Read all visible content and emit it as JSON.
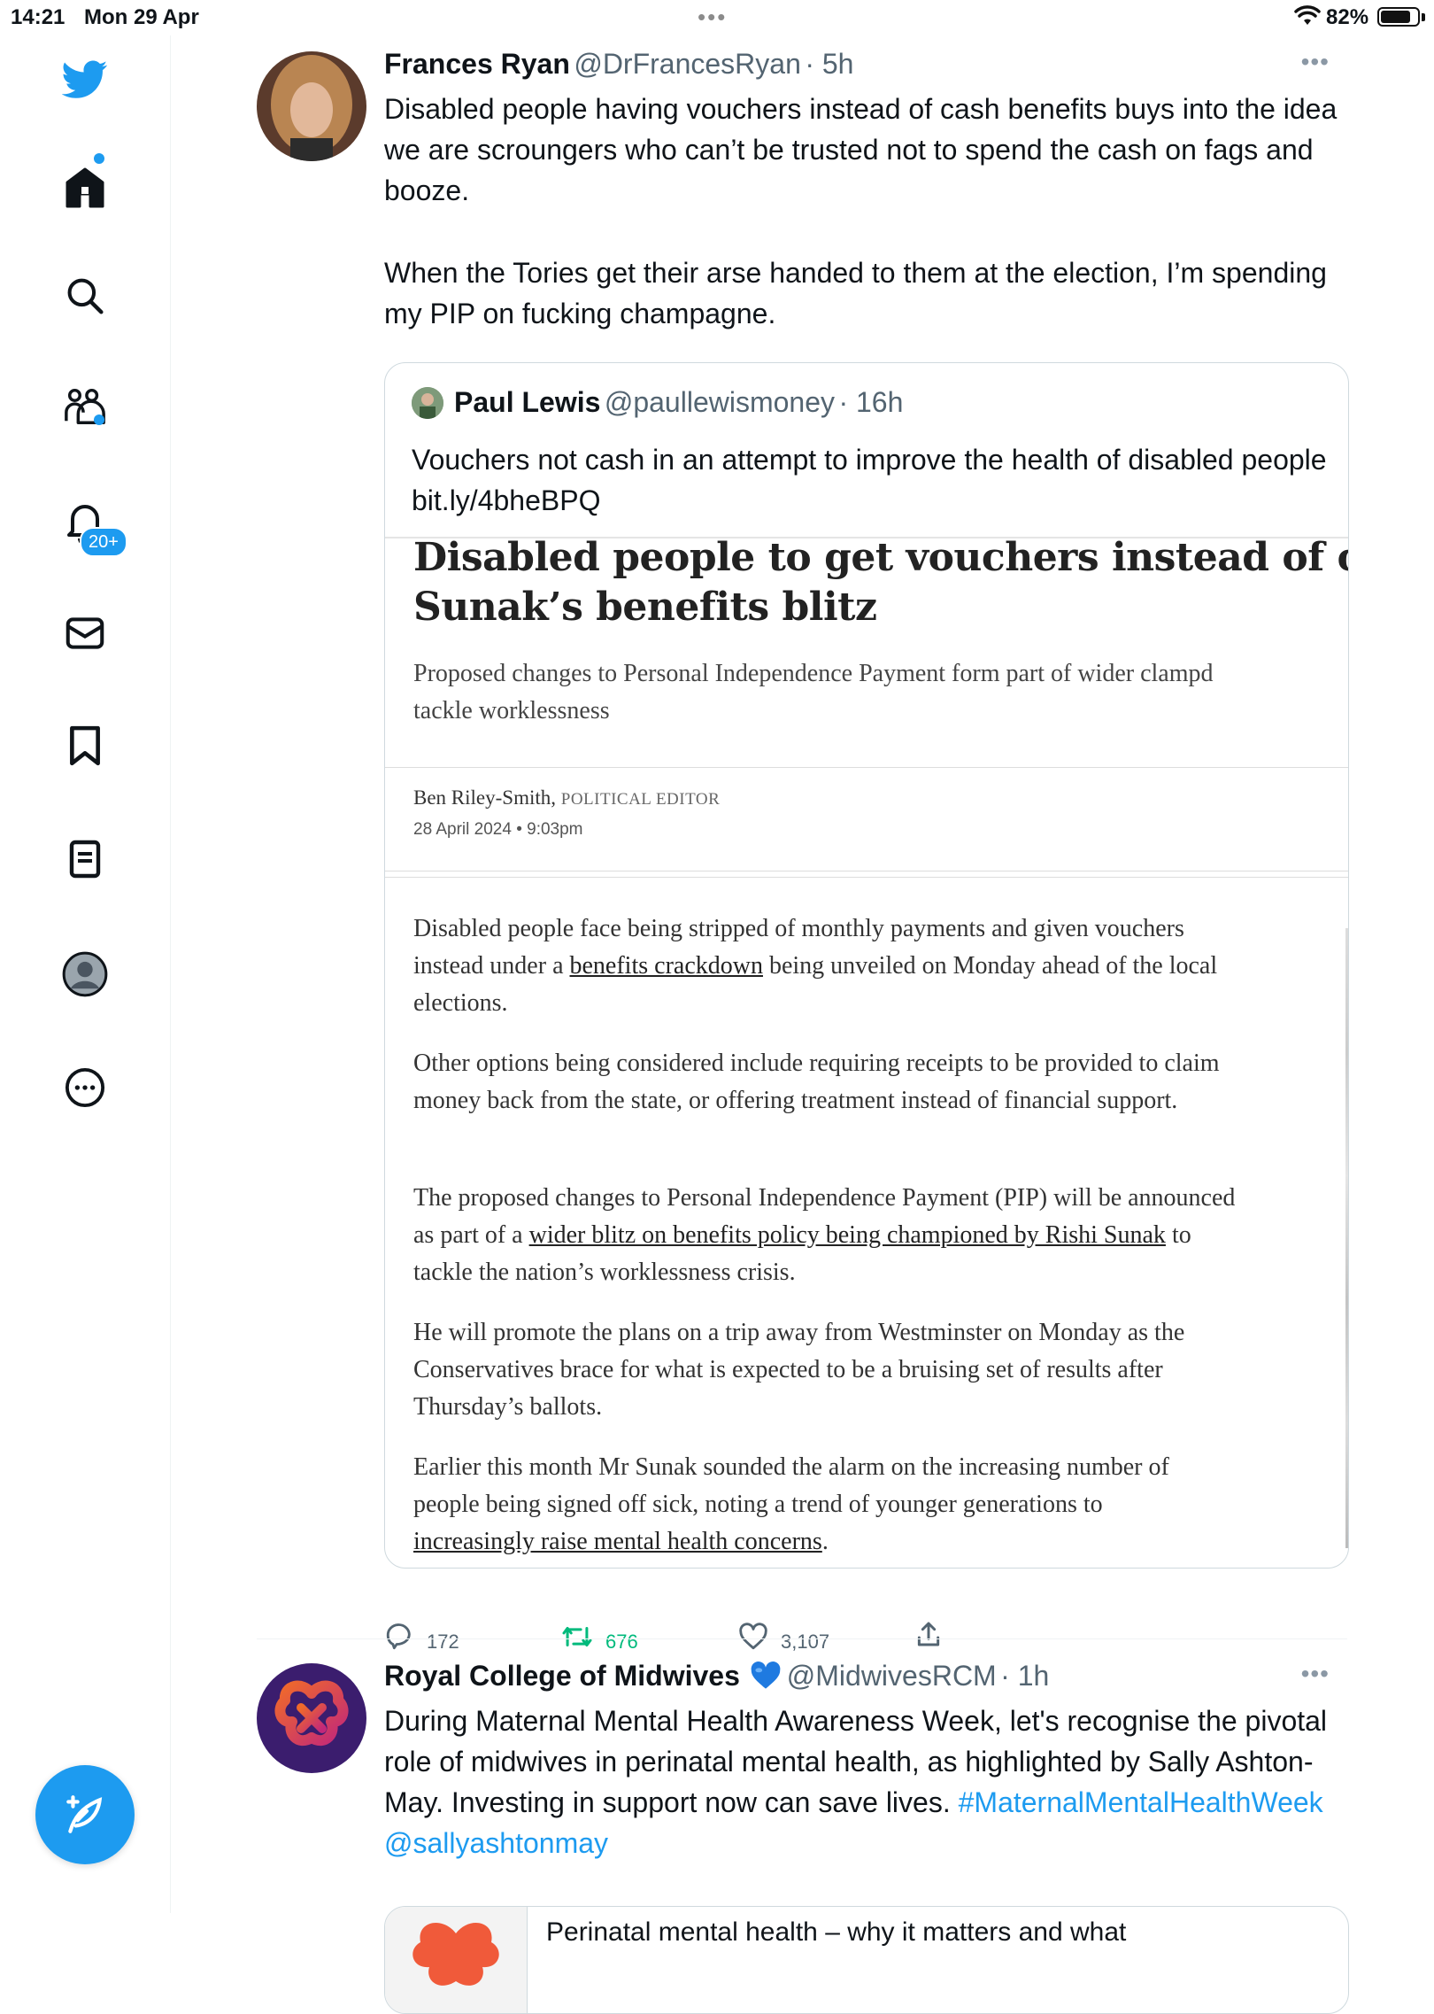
{
  "status_bar": {
    "time": "14:21",
    "date": "Mon 29 Apr",
    "battery": "82%",
    "battery_level": 0.82
  },
  "sidebar": {
    "notifications_badge": "20+",
    "icons": [
      "twitter-bird-icon",
      "home-icon",
      "search-icon",
      "communities-icon",
      "notifications-icon",
      "messages-icon",
      "bookmarks-icon",
      "lists-icon",
      "profile-icon",
      "more-icon"
    ],
    "accent": "#1d9bf0"
  },
  "tweet1": {
    "name": "Frances Ryan",
    "handle": "@DrFrancesRyan",
    "time": "· 5h",
    "text_p1": "Disabled people having vouchers instead of cash benefits buys into the idea we are scroungers who can’t be trusted not to spend the cash on fags and booze.",
    "text_p2": "When the Tories get their arse handed to them at the election, I’m spending my PIP on fucking champagne.",
    "quote": {
      "name": "Paul Lewis",
      "handle": "@paullewismoney",
      "time": "· 16h",
      "text": "Vouchers not cash in an attempt to improve the health of disabled people bit.ly/4bheBPQ",
      "article": {
        "title_l1": "Disabled people to get vouchers instead of cash in",
        "title_l2": "Sunak’s benefits blitz",
        "sub_l1": "Proposed changes to Personal Independence Payment form part of wider clampd",
        "sub_l2": "tackle worklessness",
        "author": "Ben Riley-Smith,",
        "role": "POLITICAL EDITOR",
        "date": "28 April 2024 • 9:03pm",
        "p1_a": "Disabled people face being stripped of monthly payments and given vouchers instead under a ",
        "p1_link": "benefits crackdown",
        "p1_b": " being unveiled on Monday ahead of the local elections.",
        "p2": "Other options being considered include requiring receipts to be provided to claim money back from the state, or offering treatment instead of financial support.",
        "p3_a": "The proposed changes to Personal Independence Payment (PIP) will be announced as part of a ",
        "p3_link": "wider blitz on benefits policy being championed by Rishi Sunak",
        "p3_b": " to tackle the nation’s worklessness crisis.",
        "p4": "He will promote the plans on a trip away from Westminster on Monday as the Conservatives brace for what is expected to be a bruising set of results after Thursday’s ballots.",
        "p5_a": "Earlier this month Mr Sunak sounded the alarm on the increasing number of people being signed off sick, noting a trend of younger generations to ",
        "p5_link": "increasingly raise mental health concerns",
        "p5_b": "."
      }
    },
    "replies": "172",
    "retweets": "676",
    "likes": "3,107"
  },
  "tweet2": {
    "name": "Royal College of Midwives",
    "handle": "@MidwivesRCM",
    "time": "· 1h",
    "text": "During Maternal Mental Health Awareness Week, let's recognise the pivotal role of midwives in perinatal mental health, as highlighted by Sally Ashton-May. Investing in support now can save lives.",
    "hashtag": "#MaternalMentalHealthWeek",
    "mention": "@sallyashtonmay",
    "card_title": "Perinatal mental health – why it matters and what"
  }
}
